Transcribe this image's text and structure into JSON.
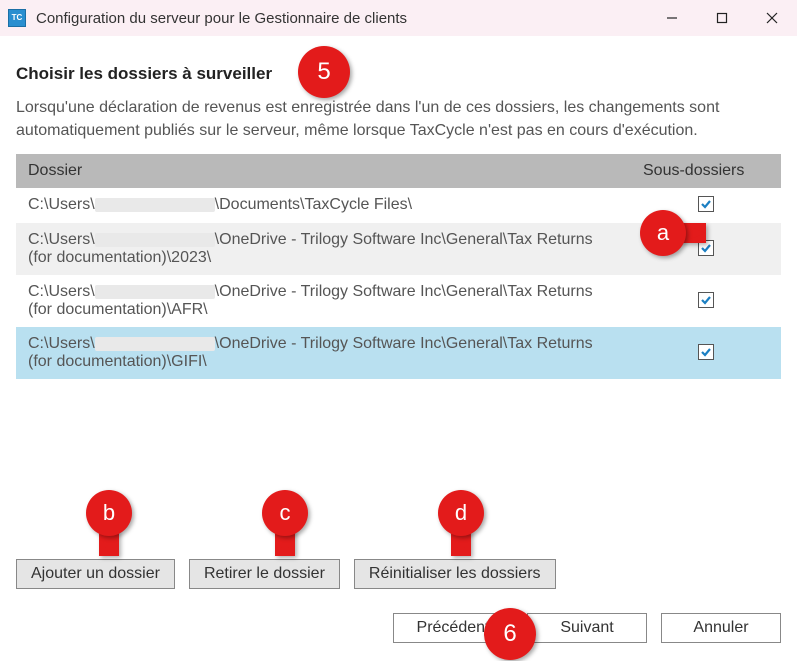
{
  "window": {
    "title": "Configuration du serveur pour le Gestionnaire de clients",
    "icon_label": "TC"
  },
  "heading": "Choisir les dossiers à surveiller",
  "description": "Lorsqu'une déclaration de revenus est enregistrée dans l'un de ces dossiers, les changements sont automatiquement publiés sur le serveur, même lorsque TaxCycle n'est pas en cours d'exécution.",
  "table": {
    "col_folder": "Dossier",
    "col_subfolders": "Sous-dossiers",
    "rows": [
      {
        "prefix": "C:\\Users\\",
        "suffix": "\\Documents\\TaxCycle Files\\",
        "checked": true,
        "selected": false
      },
      {
        "prefix": "C:\\Users\\",
        "suffix": "\\OneDrive - Trilogy Software Inc\\General\\Tax Returns (for documentation)\\2023\\",
        "checked": true,
        "selected": false
      },
      {
        "prefix": "C:\\Users\\",
        "suffix": "\\OneDrive - Trilogy Software Inc\\General\\Tax Returns (for documentation)\\AFR\\",
        "checked": true,
        "selected": false
      },
      {
        "prefix": "C:\\Users\\",
        "suffix": "\\OneDrive - Trilogy Software Inc\\General\\Tax Returns (for documentation)\\GIFI\\",
        "checked": true,
        "selected": true
      }
    ]
  },
  "buttons": {
    "add": "Ajouter un dossier",
    "remove": "Retirer le dossier",
    "reset": "Réinitialiser les dossiers"
  },
  "nav": {
    "prev": "Précédent",
    "next": "Suivant",
    "cancel": "Annuler"
  },
  "callouts": {
    "five": "5",
    "six": "6",
    "a": "a",
    "b": "b",
    "c": "c",
    "d": "d"
  }
}
